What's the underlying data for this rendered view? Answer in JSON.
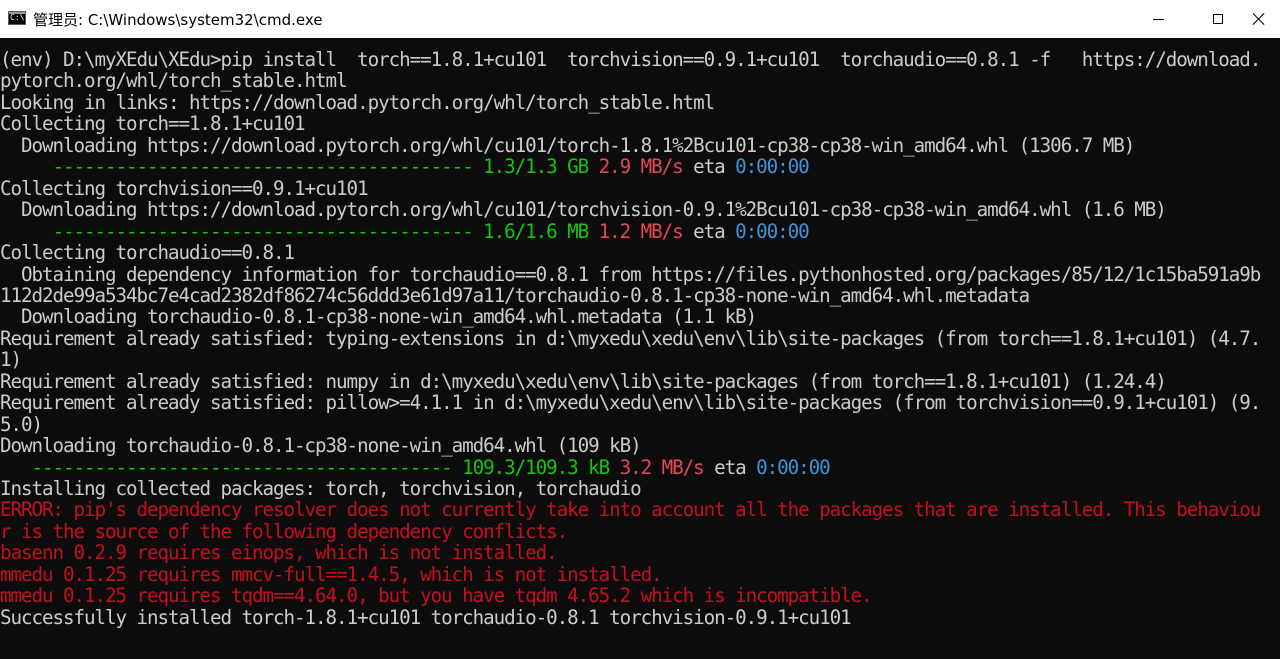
{
  "window": {
    "title": "管理员: C:\\Windows\\system32\\cmd.exe",
    "icon": "cmd-icon",
    "icon_glyph": "C:\\"
  },
  "console": {
    "lines": [
      {
        "segments": [
          {
            "text": "(env) D:\\myXEdu\\XEdu>pip install  torch==1.8.1+cu101  torchvision==0.9.1+cu101  torchaudio==0.8.1 -f   https://download.",
            "color": "default"
          }
        ]
      },
      {
        "segments": [
          {
            "text": "pytorch.org/whl/torch_stable.html",
            "color": "default"
          }
        ]
      },
      {
        "segments": [
          {
            "text": "Looking in links: https://download.pytorch.org/whl/torch_stable.html",
            "color": "default"
          }
        ]
      },
      {
        "segments": [
          {
            "text": "Collecting torch==1.8.1+cu101",
            "color": "default"
          }
        ]
      },
      {
        "segments": [
          {
            "text": "  Downloading https://download.pytorch.org/whl/cu101/torch-1.8.1%2Bcu101-cp38-cp38-win_amd64.whl (1306.7 MB)",
            "color": "default"
          }
        ]
      },
      {
        "segments": [
          {
            "text": "     ---------------------------------------- ",
            "color": "green"
          },
          {
            "text": "1.3/1.3 GB",
            "color": "green"
          },
          {
            "text": " ",
            "color": "default"
          },
          {
            "text": "2.9 MB/s",
            "color": "red"
          },
          {
            "text": " eta ",
            "color": "default"
          },
          {
            "text": "0:00:00",
            "color": "cyan"
          }
        ]
      },
      {
        "segments": [
          {
            "text": "Collecting torchvision==0.9.1+cu101",
            "color": "default"
          }
        ]
      },
      {
        "segments": [
          {
            "text": "  Downloading https://download.pytorch.org/whl/cu101/torchvision-0.9.1%2Bcu101-cp38-cp38-win_amd64.whl (1.6 MB)",
            "color": "default"
          }
        ]
      },
      {
        "segments": [
          {
            "text": "     ---------------------------------------- ",
            "color": "green"
          },
          {
            "text": "1.6/1.6 MB",
            "color": "green"
          },
          {
            "text": " ",
            "color": "default"
          },
          {
            "text": "1.2 MB/s",
            "color": "red"
          },
          {
            "text": " eta ",
            "color": "default"
          },
          {
            "text": "0:00:00",
            "color": "cyan"
          }
        ]
      },
      {
        "segments": [
          {
            "text": "Collecting torchaudio==0.8.1",
            "color": "default"
          }
        ]
      },
      {
        "segments": [
          {
            "text": "  Obtaining dependency information for torchaudio==0.8.1 from https://files.pythonhosted.org/packages/85/12/1c15ba591a9b",
            "color": "default"
          }
        ]
      },
      {
        "segments": [
          {
            "text": "112d2de99a534bc7e4cad2382df86274c56ddd3e61d97a11/torchaudio-0.8.1-cp38-none-win_amd64.whl.metadata",
            "color": "default"
          }
        ]
      },
      {
        "segments": [
          {
            "text": "  Downloading torchaudio-0.8.1-cp38-none-win_amd64.whl.metadata (1.1 kB)",
            "color": "default"
          }
        ]
      },
      {
        "segments": [
          {
            "text": "Requirement already satisfied: typing-extensions in d:\\myxedu\\xedu\\env\\lib\\site-packages (from torch==1.8.1+cu101) (4.7.",
            "color": "default"
          }
        ]
      },
      {
        "segments": [
          {
            "text": "1)",
            "color": "default"
          }
        ]
      },
      {
        "segments": [
          {
            "text": "Requirement already satisfied: numpy in d:\\myxedu\\xedu\\env\\lib\\site-packages (from torch==1.8.1+cu101) (1.24.4)",
            "color": "default"
          }
        ]
      },
      {
        "segments": [
          {
            "text": "Requirement already satisfied: pillow>=4.1.1 in d:\\myxedu\\xedu\\env\\lib\\site-packages (from torchvision==0.9.1+cu101) (9.",
            "color": "default"
          }
        ]
      },
      {
        "segments": [
          {
            "text": "5.0)",
            "color": "default"
          }
        ]
      },
      {
        "segments": [
          {
            "text": "Downloading torchaudio-0.8.1-cp38-none-win_amd64.whl (109 kB)",
            "color": "default"
          }
        ]
      },
      {
        "segments": [
          {
            "text": "   ---------------------------------------- ",
            "color": "green"
          },
          {
            "text": "109.3/109.3 kB",
            "color": "green"
          },
          {
            "text": " ",
            "color": "default"
          },
          {
            "text": "3.2 MB/s",
            "color": "red"
          },
          {
            "text": " eta ",
            "color": "default"
          },
          {
            "text": "0:00:00",
            "color": "cyan"
          }
        ]
      },
      {
        "segments": [
          {
            "text": "Installing collected packages: torch, torchvision, torchaudio",
            "color": "default"
          }
        ]
      },
      {
        "segments": [
          {
            "text": "ERROR: pip's dependency resolver does not currently take into account all the packages that are installed. This behaviou",
            "color": "err"
          }
        ]
      },
      {
        "segments": [
          {
            "text": "r is the source of the following dependency conflicts.",
            "color": "err"
          }
        ]
      },
      {
        "segments": [
          {
            "text": "basenn 0.2.9 requires einops, which is not installed.",
            "color": "err"
          }
        ]
      },
      {
        "segments": [
          {
            "text": "mmedu 0.1.25 requires mmcv-full==1.4.5, which is not installed.",
            "color": "err"
          }
        ]
      },
      {
        "segments": [
          {
            "text": "mmedu 0.1.25 requires tqdm==4.64.0, but you have tqdm 4.65.2 which is incompatible.",
            "color": "err"
          }
        ]
      },
      {
        "segments": [
          {
            "text": "Successfully installed torch-1.8.1+cu101 torchaudio-0.8.1 torchvision-0.9.1+cu101",
            "color": "default"
          }
        ]
      }
    ]
  },
  "colors": {
    "default": "#cccccc",
    "green": "#16c60c",
    "red": "#e74856",
    "cyan": "#3a96dd",
    "err": "#c50f1f",
    "background": "#0c0c0c"
  }
}
